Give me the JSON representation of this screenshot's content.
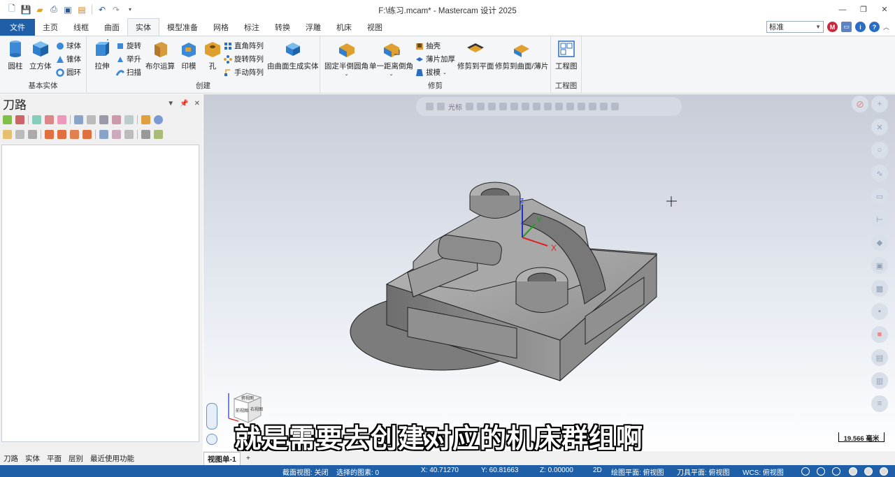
{
  "title_bar": {
    "title": "F:\\练习.mcam* - Mastercam 设计 2025"
  },
  "ribbon_tabs": [
    {
      "label": "文件"
    },
    {
      "label": "主页"
    },
    {
      "label": "线框"
    },
    {
      "label": "曲面"
    },
    {
      "label": "实体"
    },
    {
      "label": "模型准备"
    },
    {
      "label": "网格"
    },
    {
      "label": "标注"
    },
    {
      "label": "转换"
    },
    {
      "label": "浮雕"
    },
    {
      "label": "机床"
    },
    {
      "label": "视图"
    }
  ],
  "style_select": {
    "value": "标准"
  },
  "ribbon": {
    "basic_solids": {
      "label": "基本实体",
      "cylinder": "圆柱",
      "cube": "立方体",
      "sphere": "球体",
      "cone": "锥体",
      "torus": "圆环"
    },
    "create": {
      "label": "创建",
      "extrude": "拉伸",
      "revolve": "旋转",
      "loft": "举升",
      "sweep": "扫描",
      "boolean": "布尔运算",
      "imprint": "印模",
      "hole": "孔",
      "rect_pattern": "直角阵列",
      "rot_pattern": "旋转阵列",
      "manual_pattern": "手动阵列",
      "from_surfaces": "由曲面生成实体"
    },
    "modify": {
      "label": "修剪",
      "const_fillet": "固定半倒圆角",
      "one_dist_chamfer": "单一距离倒角",
      "shell": "抽壳",
      "thicken": "薄片加厚",
      "draft": "拔模",
      "trim_plane": "修剪到平面",
      "trim_surface": "修剪到曲面/薄片"
    },
    "drawing": {
      "label": "工程图",
      "layout": "工程图"
    }
  },
  "left_panel": {
    "title": "刀路"
  },
  "bottom_tabs": [
    "刀路",
    "实体",
    "平面",
    "层别",
    "最近使用功能"
  ],
  "viewport": {
    "toolbar_cursor_label": "光标",
    "subtitle": "就是需要去创建对应的机床群组啊",
    "scale_label": "19.566 毫米",
    "axis_labels": {
      "x": "X",
      "y": "Y",
      "z": "Z"
    },
    "cube_labels": {
      "top": "俯视图",
      "front": "前视图",
      "right": "右视图"
    }
  },
  "view_tabs": {
    "active": "视图单-1",
    "add": "+"
  },
  "status_bar": {
    "section_view": "截面视图: 关闭",
    "selected": "选择的图素: 0",
    "x": "X:   40.71270",
    "y": "Y:   60.81663",
    "z": "Z:   0.00000",
    "mode": "2D",
    "plane": "绘图平面: 俯视图",
    "tool_plane": "刀具平面: 俯视图",
    "wcs": "WCS: 俯视图"
  }
}
